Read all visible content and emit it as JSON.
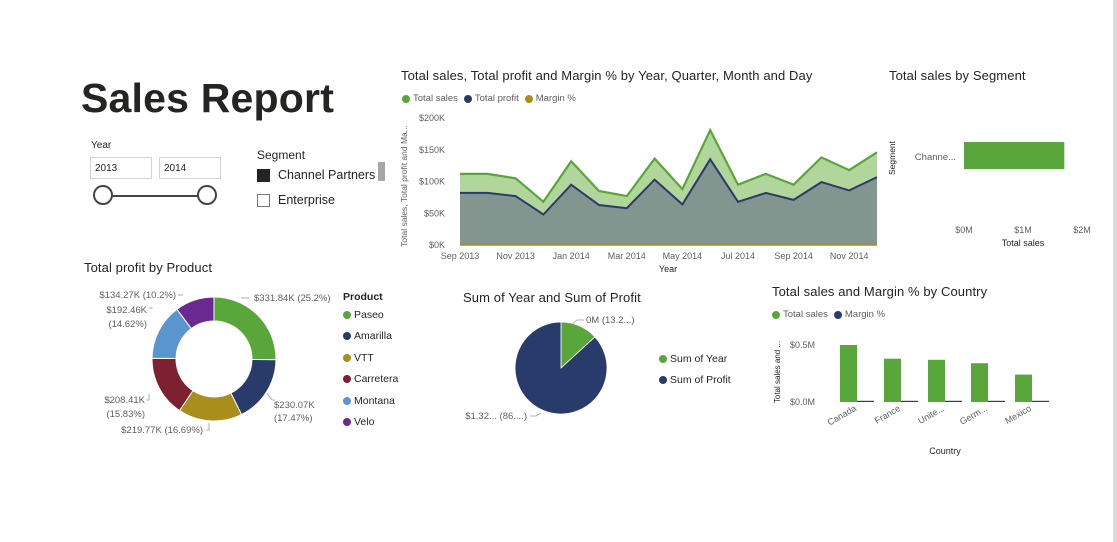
{
  "report": {
    "title": "Sales Report"
  },
  "colors": {
    "green": "#59a73b",
    "navy": "#293b6b",
    "gold": "#a98e1c",
    "maroon": "#7d2030",
    "blue": "#5b95d0",
    "purple": "#6a2a91",
    "area_green": "#b2d59c",
    "area_gray": "#82958f"
  },
  "year_slicer": {
    "label": "Year",
    "from": "2013",
    "to": "2014"
  },
  "segment_slicer": {
    "label": "Segment",
    "items": [
      {
        "label": "Channel Partners",
        "checked": true
      },
      {
        "label": "Enterprise",
        "checked": false
      }
    ]
  },
  "line_chart": {
    "title": "Total sales, Total profit and Margin % by Year, Quarter, Month and Day",
    "legend": [
      "Total sales",
      "Total profit",
      "Margin %"
    ],
    "ylabel": "Total sales, Total profit and Ma...",
    "xlabel": "Year",
    "y_ticks": [
      "$200K",
      "$150K",
      "$100K",
      "$50K",
      "$0K"
    ],
    "x_ticks": [
      "Sep 2013",
      "Nov 2013",
      "Jan 2014",
      "Mar 2014",
      "May 2014",
      "Jul 2014",
      "Sep 2014",
      "Nov 2014"
    ]
  },
  "segment_chart": {
    "title": "Total sales by Segment",
    "ylabel": "Segment",
    "category": "Channe...",
    "x_ticks": [
      "$0M",
      "$1M",
      "$2M"
    ],
    "xlabel": "Total sales"
  },
  "product_chart": {
    "title": "Total profit by Product",
    "legend_title": "Product",
    "labels": {
      "paseo": "$331.84K (25.2%)",
      "amarilla_1": "$230.07K",
      "amarilla_2": "(17.47%)",
      "vtt": "$219.77K (16.69%)",
      "carretera_1": "$208.41K",
      "carretera_2": "(15.83%)",
      "montana_1": "$192.46K",
      "montana_2": "(14.62%)",
      "velo": "$134.27K (10.2%)"
    }
  },
  "pie_chart": {
    "title": "Sum of Year and Sum of Profit",
    "legend": [
      "Sum of Year",
      "Sum of Profit"
    ],
    "label_small": "0M (13.2...)",
    "label_large": "$1.32... (86....)"
  },
  "country_chart": {
    "title": "Total sales and Margin % by Country",
    "legend": [
      "Total sales",
      "Margin %"
    ],
    "ylabel": "Total sales and ...",
    "y_ticks": [
      "$0.5M",
      "$0.0M"
    ],
    "xlabel": "Country"
  },
  "chart_data": [
    {
      "type": "area",
      "title": "Total sales, Total profit and Margin % by Year, Quarter, Month and Day",
      "xlabel": "Year",
      "ylabel": "Total sales, Total profit and Ma...",
      "ylim": [
        0,
        200000
      ],
      "x": [
        "Sep 2013",
        "Oct 2013",
        "Nov 2013",
        "Dec 2013",
        "Jan 2014",
        "Feb 2014",
        "Mar 2014",
        "Apr 2014",
        "May 2014",
        "Jun 2014",
        "Jul 2014",
        "Aug 2014",
        "Sep 2014",
        "Oct 2014",
        "Nov 2014",
        "Dec 2014"
      ],
      "series": [
        {
          "name": "Total sales",
          "values": [
            112000,
            112000,
            105000,
            68000,
            132000,
            85000,
            77000,
            136000,
            88000,
            181000,
            95000,
            112000,
            95000,
            138000,
            118000,
            146000
          ]
        },
        {
          "name": "Total profit",
          "values": [
            82000,
            82000,
            77000,
            48000,
            95000,
            63000,
            58000,
            103000,
            64000,
            135000,
            68000,
            82000,
            71000,
            99000,
            86000,
            107000
          ]
        },
        {
          "name": "Margin %",
          "values": [
            1,
            1,
            1,
            1,
            1,
            1,
            1,
            1,
            1,
            1,
            1,
            1,
            1,
            1,
            1,
            1
          ]
        }
      ],
      "legend": "top-left",
      "grid": false
    },
    {
      "type": "bar",
      "title": "Total sales by Segment",
      "orientation": "horizontal",
      "categories": [
        "Channe..."
      ],
      "values": [
        1.7
      ],
      "xlim": [
        0,
        2
      ],
      "xlabel": "Total sales",
      "ylabel": "Segment",
      "unit": "$M"
    },
    {
      "type": "pie",
      "donut": true,
      "title": "Total profit by Product",
      "categories": [
        "Paseo",
        "Amarilla",
        "VTT",
        "Carretera",
        "Montana",
        "Velo"
      ],
      "values": [
        331.84,
        230.07,
        219.77,
        208.41,
        192.46,
        134.27
      ],
      "unit": "$K",
      "colors": [
        "#59a73b",
        "#293b6b",
        "#a98e1c",
        "#7d2030",
        "#5b95d0",
        "#6a2a91"
      ],
      "legend": "right"
    },
    {
      "type": "pie",
      "title": "Sum of Year and Sum of Profit",
      "categories": [
        "Sum of Year",
        "Sum of Profit"
      ],
      "values": [
        13.2,
        86.8
      ],
      "colors": [
        "#59a73b",
        "#293b6b"
      ],
      "legend": "right"
    },
    {
      "type": "bar",
      "title": "Total sales and Margin % by Country",
      "categories": [
        "Canada",
        "France",
        "Unite...",
        "Germ...",
        "Mexico"
      ],
      "series": [
        {
          "name": "Total sales",
          "values": [
            0.5,
            0.38,
            0.37,
            0.34,
            0.24
          ]
        },
        {
          "name": "Margin %",
          "values": [
            0.005,
            0.005,
            0.005,
            0.005,
            0.005
          ]
        }
      ],
      "ylim": [
        0,
        0.5
      ],
      "unit": "$M",
      "xlabel": "Country",
      "ylabel": "Total sales and ...",
      "legend": "top-left"
    }
  ]
}
